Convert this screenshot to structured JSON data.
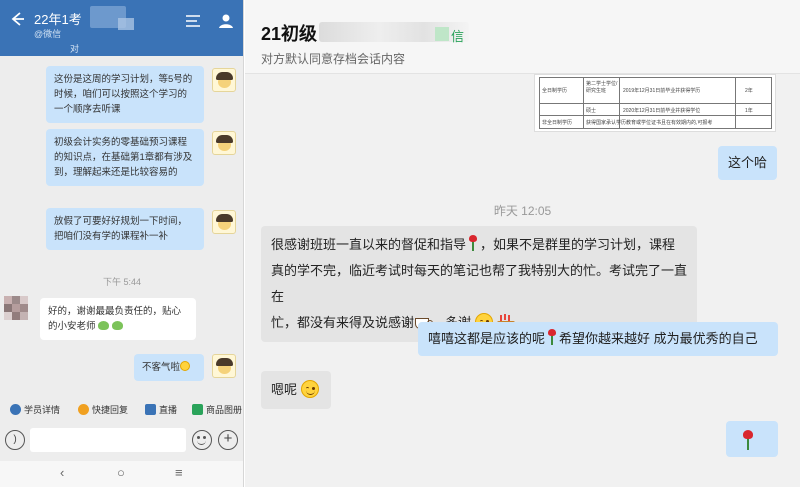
{
  "phone": {
    "title": "22年1考",
    "subtitle": "@微信",
    "note": "对",
    "messages": [
      {
        "text": "这份是这周的学习计划，等5号的时候，咱们可以按照这个学习的一个顺序去听课"
      },
      {
        "text": "初级会计实务的零基础预习课程的知识点，在基础第1章都有涉及到，理解起来还是比较容易的"
      },
      {
        "text": "放假了可要好好规划一下时间，把咱们没有学的课程补一补"
      },
      {
        "time": "下午 5:44"
      },
      {
        "text": "好的，谢谢最最负责任的，贴心的小安老师"
      },
      {
        "text": "不客气啦"
      }
    ],
    "tools": [
      "学员详情",
      "快捷回复",
      "直播",
      "商品图册"
    ],
    "nav": [
      "‹",
      "○",
      "≡"
    ]
  },
  "chat": {
    "title": "21初级",
    "title_tag": "信",
    "subtitle": "对方默认同意存档会话内容",
    "doc": {
      "r1c1": "全日制学历",
      "r1c2": "第二学士学位/研究生班",
      "r1c3": "2019年12月31日前毕业并获得学历",
      "r1c4": "2年",
      "r2c2": "硕士",
      "r2c3": "2020年12月31日前毕业并获得学位",
      "r2c4": "1年",
      "r3c1": "非全日制学历",
      "r3c3": "获得国家承认学历教育或学位证书且在有效期内的,可报考"
    },
    "messages": [
      {
        "dir": "out",
        "text": "这个哈"
      },
      {
        "time": "昨天 12:05"
      },
      {
        "dir": "in",
        "line1a": "很感谢班班一直以来的督促和指导",
        "line1b": "，如果不是群里的学习计划，课程",
        "line2": "真的学不完，临近考试时每天的笔记也帮了我特别大的忙。考试完了一直在",
        "line3a": "忙，都没有来得及说感谢",
        "line3b": "，多谢"
      },
      {
        "dir": "out",
        "text_a": "嘻嘻这都是应该的呢",
        "text_b": "希望你越来越好 成为最优秀的自己"
      },
      {
        "dir": "in",
        "text": "嗯呢"
      },
      {
        "dir": "out",
        "sticker": "rose-icon"
      }
    ]
  },
  "colors": {
    "phone_header": "#3a73b6",
    "bubble_out": "#c9e3fb",
    "bubble_in": "#e4e4e4",
    "tag_green": "#2aa35a"
  }
}
